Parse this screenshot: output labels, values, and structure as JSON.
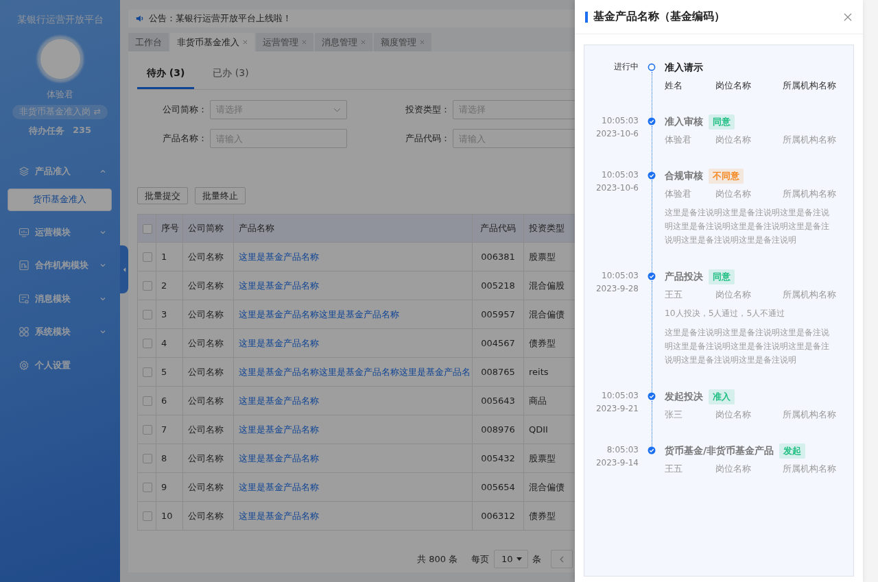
{
  "sidebar": {
    "title": "某银行运营开放平台",
    "user": {
      "name": "体验君",
      "role": "非货币基金准入岗 ⇄",
      "todo_label": "待办任务",
      "todo_count": "235"
    },
    "menu": [
      {
        "label": "产品准入",
        "kind": "group",
        "expanded": true,
        "children": [
          {
            "label": "货币基金准入",
            "selected": true
          }
        ]
      },
      {
        "label": "运营模块",
        "kind": "group",
        "expanded": false
      },
      {
        "label": "合作机构模块",
        "kind": "group",
        "expanded": false
      },
      {
        "label": "消息模块",
        "kind": "group",
        "expanded": false
      },
      {
        "label": "系统模块",
        "kind": "group",
        "expanded": false
      },
      {
        "label": "个人设置",
        "kind": "link"
      }
    ]
  },
  "announcement": "公告：某银行运营开放平台上线啦！",
  "tabs": [
    {
      "label": "工作台",
      "closable": false,
      "selected": false
    },
    {
      "label": "非货币基金准入",
      "closable": true,
      "selected": true
    },
    {
      "label": "运营管理",
      "closable": true,
      "selected": false
    },
    {
      "label": "消息管理",
      "closable": true,
      "selected": false
    },
    {
      "label": "额度管理",
      "closable": true,
      "selected": false
    }
  ],
  "subtabs": [
    {
      "label": "待办 (3)",
      "selected": true
    },
    {
      "label": "已办 (3)",
      "selected": false
    }
  ],
  "filters": [
    {
      "label": "公司简称：",
      "kind": "select",
      "placeholder": "请选择"
    },
    {
      "label": "投资类型：",
      "kind": "select_cut",
      "placeholder": "请选择"
    },
    {
      "label": "产品名称：",
      "kind": "input",
      "placeholder": "请输入"
    },
    {
      "label": "产品代码：",
      "kind": "input",
      "placeholder": "请输入"
    }
  ],
  "actions": [
    "批量提交",
    "批量终止"
  ],
  "table": {
    "all_checked": false,
    "columns": [
      "序号",
      "公司简称",
      "产品名称",
      "产品代码",
      "投资类型"
    ],
    "rows": [
      {
        "checked": false,
        "cells": [
          "1",
          "公司名称",
          "这里是基金产品名称",
          "006381",
          "股票型"
        ]
      },
      {
        "checked": false,
        "cells": [
          "2",
          "公司名称",
          "这里是基金产品名称",
          "005218",
          "混合偏股"
        ]
      },
      {
        "checked": false,
        "cells": [
          "3",
          "公司名称",
          "这里是基金产品名称这里是基金产品名称",
          "005957",
          "混合偏债"
        ]
      },
      {
        "checked": false,
        "cells": [
          "4",
          "公司名称",
          "这里是基金产品名称",
          "004567",
          "债券型"
        ]
      },
      {
        "checked": false,
        "cells": [
          "5",
          "公司名称",
          "这里是基金产品名称这里是基金产品名称这里是基金产品名",
          "008765",
          "reits"
        ]
      },
      {
        "checked": false,
        "cells": [
          "6",
          "公司名称",
          "这里是基金产品名称",
          "005643",
          "商品"
        ]
      },
      {
        "checked": false,
        "cells": [
          "7",
          "公司名称",
          "这里是基金产品名称",
          "008976",
          "QDII"
        ]
      },
      {
        "checked": false,
        "cells": [
          "8",
          "公司名称",
          "这里是基金产品名称",
          "005432",
          "股票型"
        ]
      },
      {
        "checked": false,
        "cells": [
          "9",
          "公司名称",
          "这里是基金产品名称",
          "005654",
          "混合偏债"
        ]
      },
      {
        "checked": false,
        "cells": [
          "10",
          "公司名称",
          "这里是基金产品名称",
          "006312",
          "债券型"
        ]
      }
    ]
  },
  "pagination": {
    "total": "共 800 条",
    "per_page_label": "每页",
    "page_size": "10",
    "unit": "条"
  },
  "drawer": {
    "title": "基金产品名称（基金编码）",
    "timeline": [
      {
        "done": false,
        "time": "进行中",
        "title": "准入请示",
        "fields": [
          "姓名",
          "岗位名称",
          "所属机构名称"
        ]
      },
      {
        "done": true,
        "time": "10:05:03",
        "date": "2023-10-6",
        "title": "准入审核",
        "tag": {
          "label": "同意",
          "color": "#1fbf83"
        },
        "fields": [
          "体验君",
          "岗位名称",
          "所属机构名称"
        ]
      },
      {
        "done": true,
        "time": "10:05:03",
        "date": "2023-10-6",
        "title": "合规审核",
        "tag": {
          "label": "不同意",
          "color": "#f5871f"
        },
        "fields": [
          "体验君",
          "岗位名称",
          "所属机构名称"
        ],
        "remark": "这里是备注说明这里是备注说明这里是备注说明这里是备注说明这里是备注说明这里是备注说明这里是备注说明这里是备注说明"
      },
      {
        "done": true,
        "time": "10:05:03",
        "date": "2023-9-28",
        "title": "产品投决",
        "tag": {
          "label": "同意",
          "color": "#1fbf83"
        },
        "fields": [
          "王五",
          "岗位名称",
          "所属机构名称"
        ],
        "vote": "10人投决，5人通过，5人不通过",
        "remark": "这里是备注说明这里是备注说明这里是备注说明这里是备注说明这里是备注说明这里是备注说明这里是备注说明这里是备注说明"
      },
      {
        "done": true,
        "time": "10:05:03",
        "date": "2023-9-21",
        "title": "发起投决",
        "tag": {
          "label": "准入",
          "color": "#1fbf83"
        },
        "fields": [
          "张三",
          "岗位名称",
          "所属机构名称"
        ]
      },
      {
        "done": true,
        "time": "8:05:03",
        "date": "2023-9-14",
        "title": "货币基金/非货币基金产品",
        "tag": {
          "label": "发起",
          "color": "#1fbf83"
        },
        "fields": [
          "王五",
          "岗位名称",
          "所属机构名称"
        ]
      }
    ]
  }
}
